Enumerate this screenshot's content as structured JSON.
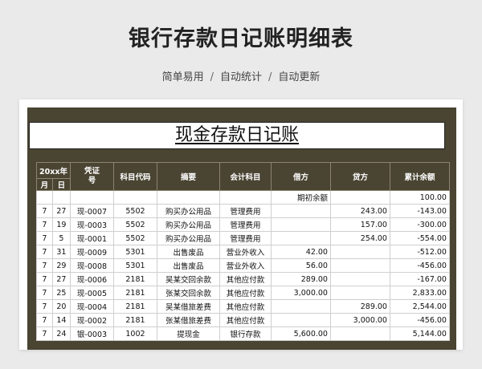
{
  "page": {
    "title": "银行存款日记账明细表",
    "tags": [
      "简单易用",
      "自动统计",
      "自动更新"
    ],
    "separator": "/"
  },
  "sheet": {
    "title": "现金存款日记账",
    "headers": {
      "year": "20xx年",
      "month": "月",
      "day": "日",
      "voucher": "凭证\n号",
      "code": "科目代码",
      "summary": "摘要",
      "account": "会计科目",
      "debit": "借方",
      "credit": "贷方",
      "balance": "累计余额"
    },
    "rows": [
      {
        "month": "",
        "day": "",
        "voucher": "",
        "code": "",
        "summary": "",
        "account": "",
        "debit": "期初余额",
        "credit": "",
        "balance": "100.00"
      },
      {
        "month": "7",
        "day": "27",
        "voucher": "现-0007",
        "code": "5502",
        "summary": "购买办公用品",
        "account": "管理费用",
        "debit": "",
        "credit": "243.00",
        "balance": "-143.00"
      },
      {
        "month": "7",
        "day": "19",
        "voucher": "现-0003",
        "code": "5502",
        "summary": "购买办公用品",
        "account": "管理费用",
        "debit": "",
        "credit": "157.00",
        "balance": "-300.00"
      },
      {
        "month": "7",
        "day": "5",
        "voucher": "现-0001",
        "code": "5502",
        "summary": "购买办公用品",
        "account": "管理费用",
        "debit": "",
        "credit": "254.00",
        "balance": "-554.00"
      },
      {
        "month": "7",
        "day": "31",
        "voucher": "现-0009",
        "code": "5301",
        "summary": "出售废品",
        "account": "营业外收入",
        "debit": "42.00",
        "credit": "",
        "balance": "-512.00"
      },
      {
        "month": "7",
        "day": "29",
        "voucher": "现-0008",
        "code": "5301",
        "summary": "出售废品",
        "account": "营业外收入",
        "debit": "56.00",
        "credit": "",
        "balance": "-456.00"
      },
      {
        "month": "7",
        "day": "27",
        "voucher": "现-0006",
        "code": "2181",
        "summary": "吴某交回余款",
        "account": "其他应付款",
        "debit": "289.00",
        "credit": "",
        "balance": "-167.00"
      },
      {
        "month": "7",
        "day": "25",
        "voucher": "现-0005",
        "code": "2181",
        "summary": "张某交回余款",
        "account": "其他应付款",
        "debit": "3,000.00",
        "credit": "",
        "balance": "2,833.00"
      },
      {
        "month": "7",
        "day": "20",
        "voucher": "现-0004",
        "code": "2181",
        "summary": "吴某借旅差费",
        "account": "其他应付款",
        "debit": "",
        "credit": "289.00",
        "balance": "2,544.00"
      },
      {
        "month": "7",
        "day": "14",
        "voucher": "现-0002",
        "code": "2181",
        "summary": "张某借旅差费",
        "account": "其他应付款",
        "debit": "",
        "credit": "3,000.00",
        "balance": "-456.00"
      },
      {
        "month": "7",
        "day": "24",
        "voucher": "银-0003",
        "code": "1002",
        "summary": "提现金",
        "account": "银行存款",
        "debit": "5,600.00",
        "credit": "",
        "balance": "5,144.00"
      }
    ]
  }
}
